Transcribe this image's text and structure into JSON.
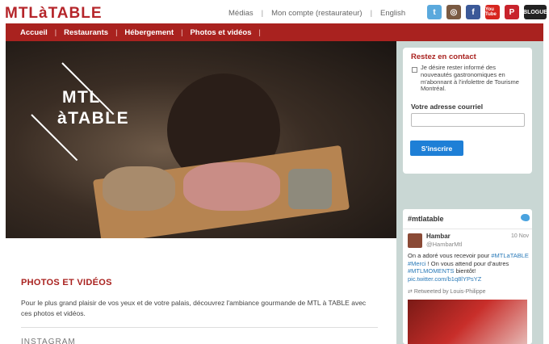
{
  "header": {
    "logo": "MTLàTABLE",
    "links": [
      "Médias",
      "Mon compte (restaurateur)",
      "English"
    ],
    "social": [
      {
        "name": "twitter-icon",
        "glyph": "t"
      },
      {
        "name": "instagram-icon",
        "glyph": "◎"
      },
      {
        "name": "facebook-icon",
        "glyph": "f"
      },
      {
        "name": "youtube-icon",
        "glyph": "You Tube"
      },
      {
        "name": "pinterest-icon",
        "glyph": "P"
      },
      {
        "name": "blog-icon",
        "glyph": "BLOGUE"
      }
    ]
  },
  "nav": {
    "items": [
      "Accueil",
      "Restaurants",
      "Hébergement",
      "Photos et vidéos"
    ]
  },
  "hero": {
    "logo_line1": "MTL",
    "logo_line2": "àTABLE"
  },
  "article": {
    "title": "PHOTOS ET VIDÉOS",
    "text": "Pour le plus grand plaisir de vos yeux et de votre palais, découvrez l'ambiance gourmande de MTL à TABLE avec ces photos et vidéos.",
    "subtitle": "INSTAGRAM"
  },
  "sidebar": {
    "contact": {
      "title": "Restez en contact",
      "checkbox_label": "Je désire rester informé des nouveautés gastronomiques en m'abonnant à l'infolettre de Tourisme Montréal.",
      "email_label": "Votre adresse courriel",
      "email_value": "",
      "subscribe_label": "S'inscrire"
    },
    "twitter": {
      "hashtag": "#mtlatable",
      "tweet": {
        "name": "Hambar",
        "handle": "@HambarMtl",
        "date": "10 Nov",
        "text_before": "On a adoré vous recevoir pour ",
        "tag1": "#MTLaTABLE",
        "tag2": "#Merci",
        "text_middle": " ! On vous attend pour d'autres ",
        "tag3": "#MTLMOMENTS",
        "text_after": " bientôt!",
        "link": "pic.twitter.com/b1q8lYPsYZ",
        "retweet": "Retweeted by Louis-Philippe"
      }
    }
  },
  "colors": {
    "brand_red": "#a9221f",
    "sidebar_bg": "#c9d7d4",
    "button_blue": "#1e7fd6"
  }
}
